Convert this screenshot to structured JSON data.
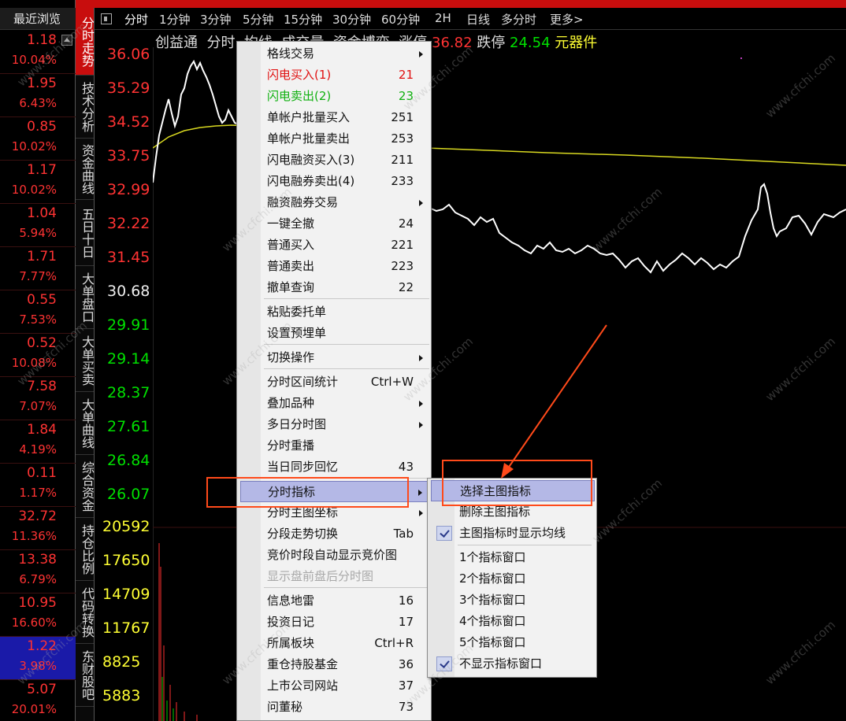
{
  "recent": {
    "header": "最近浏览",
    "items": [
      {
        "price": "1.18",
        "pct": "10.04%"
      },
      {
        "price": "1.95",
        "pct": "6.43%"
      },
      {
        "price": "0.85",
        "pct": "10.02%"
      },
      {
        "price": "1.17",
        "pct": "10.02%"
      },
      {
        "price": "1.04",
        "pct": "5.94%"
      },
      {
        "price": "1.71",
        "pct": "7.77%"
      },
      {
        "price": "0.55",
        "pct": "7.53%"
      },
      {
        "price": "0.52",
        "pct": "10.08%"
      },
      {
        "price": "7.58",
        "pct": "7.07%"
      },
      {
        "price": "1.84",
        "pct": "4.19%"
      },
      {
        "price": "0.11",
        "pct": "1.17%"
      },
      {
        "price": "32.72",
        "pct": "11.36%"
      },
      {
        "price": "13.38",
        "pct": "6.79%"
      },
      {
        "price": "10.95",
        "pct": "16.60%"
      },
      {
        "price": "1.22",
        "pct": "3.98%"
      },
      {
        "price": "5.07",
        "pct": "20.01%"
      }
    ]
  },
  "vertical_tabs": [
    "分时走势",
    "技术分析",
    "资金曲线",
    "五日十日",
    "大单盘口",
    "大单买卖",
    "大单曲线",
    "综合资金",
    "持仓比例",
    "代码转换",
    "东财股吧"
  ],
  "periods": [
    "分时",
    "1分钟",
    "3分钟",
    "5分钟",
    "15分钟",
    "30分钟",
    "60分钟",
    "2H",
    "日线",
    "多分时",
    "更多>"
  ],
  "chart_header": {
    "stock": "创益通",
    "tab1": "分时",
    "tab2": "均线",
    "tab3": "成交量",
    "tab4": "资金博弈",
    "limit_up_label": "涨停",
    "limit_up_value": "36.82",
    "limit_down_label": "跌停",
    "limit_down_value": "24.54",
    "sector": "元器件"
  },
  "y_axis": {
    "price_ticks_red": [
      "36.06",
      "35.29",
      "34.52",
      "33.75",
      "32.99",
      "32.22",
      "31.45"
    ],
    "price_tick_flat": "30.68",
    "price_ticks_green": [
      "29.91",
      "29.14",
      "28.37",
      "27.61",
      "26.84",
      "26.07"
    ],
    "volume_ticks": [
      "20592",
      "17650",
      "14709",
      "11767",
      "8825",
      "5883"
    ]
  },
  "context_menu": {
    "items": [
      {
        "label": "格线交易",
        "shortcut": "",
        "submenu": true
      },
      {
        "label": "闪电买入(1)",
        "shortcut": "21",
        "color": "red"
      },
      {
        "label": "闪电卖出(2)",
        "shortcut": "23",
        "color": "green"
      },
      {
        "label": "单帐户批量买入",
        "shortcut": "251"
      },
      {
        "label": "单帐户批量卖出",
        "shortcut": "253"
      },
      {
        "label": "闪电融资买入(3)",
        "shortcut": "211"
      },
      {
        "label": "闪电融券卖出(4)",
        "shortcut": "233"
      },
      {
        "label": "融资融券交易",
        "shortcut": "",
        "submenu": true
      },
      {
        "label": "一键全撤",
        "shortcut": "24"
      },
      {
        "label": "普通买入",
        "shortcut": "221"
      },
      {
        "label": "普通卖出",
        "shortcut": "223"
      },
      {
        "label": "撤单查询",
        "shortcut": "22"
      },
      {
        "label": "粘贴委托单",
        "shortcut": ""
      },
      {
        "label": "设置预埋单",
        "shortcut": ""
      },
      {
        "label": "切换操作",
        "shortcut": "",
        "submenu": true
      },
      {
        "label": "分时区间统计",
        "shortcut": "Ctrl+W"
      },
      {
        "label": "叠加品种",
        "shortcut": "",
        "submenu": true
      },
      {
        "label": "多日分时图",
        "shortcut": "",
        "submenu": true
      },
      {
        "label": "分时重播",
        "shortcut": ""
      },
      {
        "label": "当日同步回忆",
        "shortcut": "43"
      },
      {
        "label": "分时指标",
        "shortcut": "",
        "submenu": true,
        "highlighted": true
      },
      {
        "label": "分时主图坐标",
        "shortcut": "",
        "submenu": true
      },
      {
        "label": "分段走势切换",
        "shortcut": "Tab"
      },
      {
        "label": "竞价时段自动显示竞价图",
        "shortcut": ""
      },
      {
        "label": "显示盘前盘后分时图",
        "shortcut": "",
        "disabled": true
      },
      {
        "label": "信息地雷",
        "shortcut": "16"
      },
      {
        "label": "投资日记",
        "shortcut": "17"
      },
      {
        "label": "所属板块",
        "shortcut": "Ctrl+R"
      },
      {
        "label": "重仓持股基金",
        "shortcut": "36"
      },
      {
        "label": "上市公司网站",
        "shortcut": "37"
      },
      {
        "label": "问董秘",
        "shortcut": "73"
      }
    ]
  },
  "submenu": {
    "items": [
      {
        "label": "选择主图指标",
        "highlighted": true
      },
      {
        "label": "删除主图指标"
      },
      {
        "label": "主图指标时显示均线",
        "checked": true
      },
      {
        "label": "1个指标窗口"
      },
      {
        "label": "2个指标窗口"
      },
      {
        "label": "3个指标窗口"
      },
      {
        "label": "4个指标窗口"
      },
      {
        "label": "5个指标窗口"
      },
      {
        "label": "不显示指标窗口",
        "checked": true
      }
    ]
  },
  "watermark": "www.cfchi.com",
  "colors": {
    "up": "#ff3333",
    "down": "#00e000",
    "avg_line": "#d8d820",
    "price_line": "#ffffff",
    "annotation": "#ff4a1a",
    "menu_highlight": "#b4b8e6"
  }
}
